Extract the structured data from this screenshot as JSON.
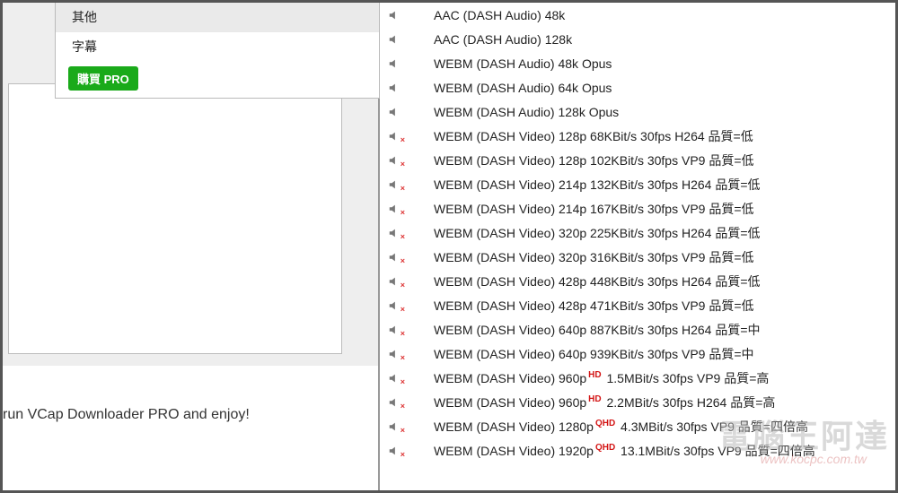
{
  "menu": {
    "item1": "其他",
    "item2": "字幕",
    "pro": "購買 PRO"
  },
  "left": {
    "runText": "run VCap Downloader PRO and enjoy!"
  },
  "watermark": {
    "main": "電腦王阿達",
    "sub": "www.kocpc.com.tw"
  },
  "rows": [
    {
      "muted": false,
      "text": "AAC (DASH Audio) 48k",
      "badge": ""
    },
    {
      "muted": false,
      "text": "AAC (DASH Audio) 128k",
      "badge": ""
    },
    {
      "muted": false,
      "text": "WEBM (DASH Audio) 48k Opus",
      "badge": ""
    },
    {
      "muted": false,
      "text": "WEBM (DASH Audio) 64k Opus",
      "badge": ""
    },
    {
      "muted": false,
      "text": "WEBM (DASH Audio) 128k Opus",
      "badge": ""
    },
    {
      "muted": true,
      "text": "WEBM (DASH Video) 128p 68KBit/s 30fps H264 品質=低",
      "badge": ""
    },
    {
      "muted": true,
      "text": "WEBM (DASH Video) 128p 102KBit/s 30fps VP9 品質=低",
      "badge": ""
    },
    {
      "muted": true,
      "text": "WEBM (DASH Video) 214p 132KBit/s 30fps H264 品質=低",
      "badge": ""
    },
    {
      "muted": true,
      "text": "WEBM (DASH Video) 214p 167KBit/s 30fps VP9 品質=低",
      "badge": ""
    },
    {
      "muted": true,
      "text": "WEBM (DASH Video) 320p 225KBit/s 30fps H264 品質=低",
      "badge": ""
    },
    {
      "muted": true,
      "text": "WEBM (DASH Video) 320p 316KBit/s 30fps VP9 品質=低",
      "badge": ""
    },
    {
      "muted": true,
      "text": "WEBM (DASH Video) 428p 448KBit/s 30fps H264 品質=低",
      "badge": ""
    },
    {
      "muted": true,
      "text": "WEBM (DASH Video) 428p 471KBit/s 30fps VP9 品質=低",
      "badge": ""
    },
    {
      "muted": true,
      "text": "WEBM (DASH Video) 640p 887KBit/s 30fps H264 品質=中",
      "badge": ""
    },
    {
      "muted": true,
      "text": "WEBM (DASH Video) 640p 939KBit/s 30fps VP9 品質=中",
      "badge": ""
    },
    {
      "muted": true,
      "text": "WEBM (DASH Video) 960p",
      "badge": "HD",
      "suffix": " 1.5MBit/s 30fps VP9 品質=高"
    },
    {
      "muted": true,
      "text": "WEBM (DASH Video) 960p",
      "badge": "HD",
      "suffix": " 2.2MBit/s 30fps H264 品質=高"
    },
    {
      "muted": true,
      "text": "WEBM (DASH Video) 1280p",
      "badge": "QHD",
      "suffix": " 4.3MBit/s 30fps VP9 品質=四倍高"
    },
    {
      "muted": true,
      "text": "WEBM (DASH Video) 1920p",
      "badge": "QHD",
      "suffix": " 13.1MBit/s 30fps VP9 品質=四倍高"
    }
  ]
}
